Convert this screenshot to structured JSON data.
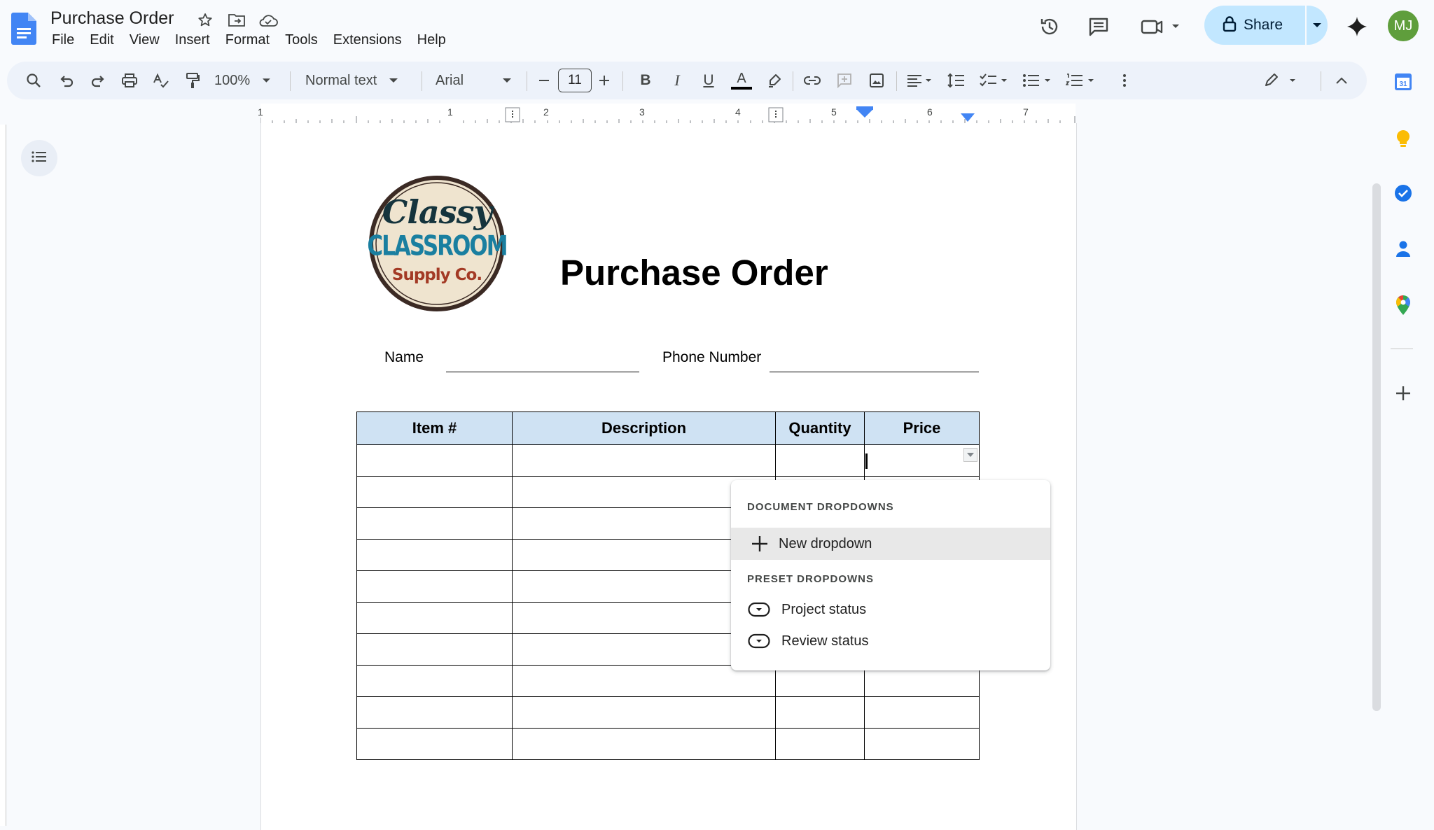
{
  "header": {
    "title": "Purchase Order",
    "menu": [
      "File",
      "Edit",
      "View",
      "Insert",
      "Format",
      "Tools",
      "Extensions",
      "Help"
    ],
    "share_label": "Share",
    "avatar_initials": "MJ"
  },
  "toolbar": {
    "zoom": "100%",
    "style": "Normal text",
    "font": "Arial",
    "font_size": "11"
  },
  "ruler": {
    "numbers": [
      "1",
      "1",
      "2",
      "3",
      "4",
      "5",
      "6",
      "7"
    ]
  },
  "document": {
    "logo_text": [
      "Classy",
      "CLASSROOM",
      "Supply Co."
    ],
    "heading": "Purchase Order",
    "name_label": "Name",
    "phone_label": "Phone Number",
    "table": {
      "headers": [
        "Item #",
        "Description",
        "Quantity",
        "Price"
      ],
      "row_count": 10
    }
  },
  "dropdown_menu": {
    "section1": "DOCUMENT DROPDOWNS",
    "new_dropdown": "New dropdown",
    "section2": "PRESET DROPDOWNS",
    "presets": [
      "Project status",
      "Review status"
    ]
  },
  "colors": {
    "accent": "#0b57d0",
    "share_bg": "#c2e7ff",
    "table_header": "#cfe2f3",
    "avatar": "#5f9e3c"
  }
}
